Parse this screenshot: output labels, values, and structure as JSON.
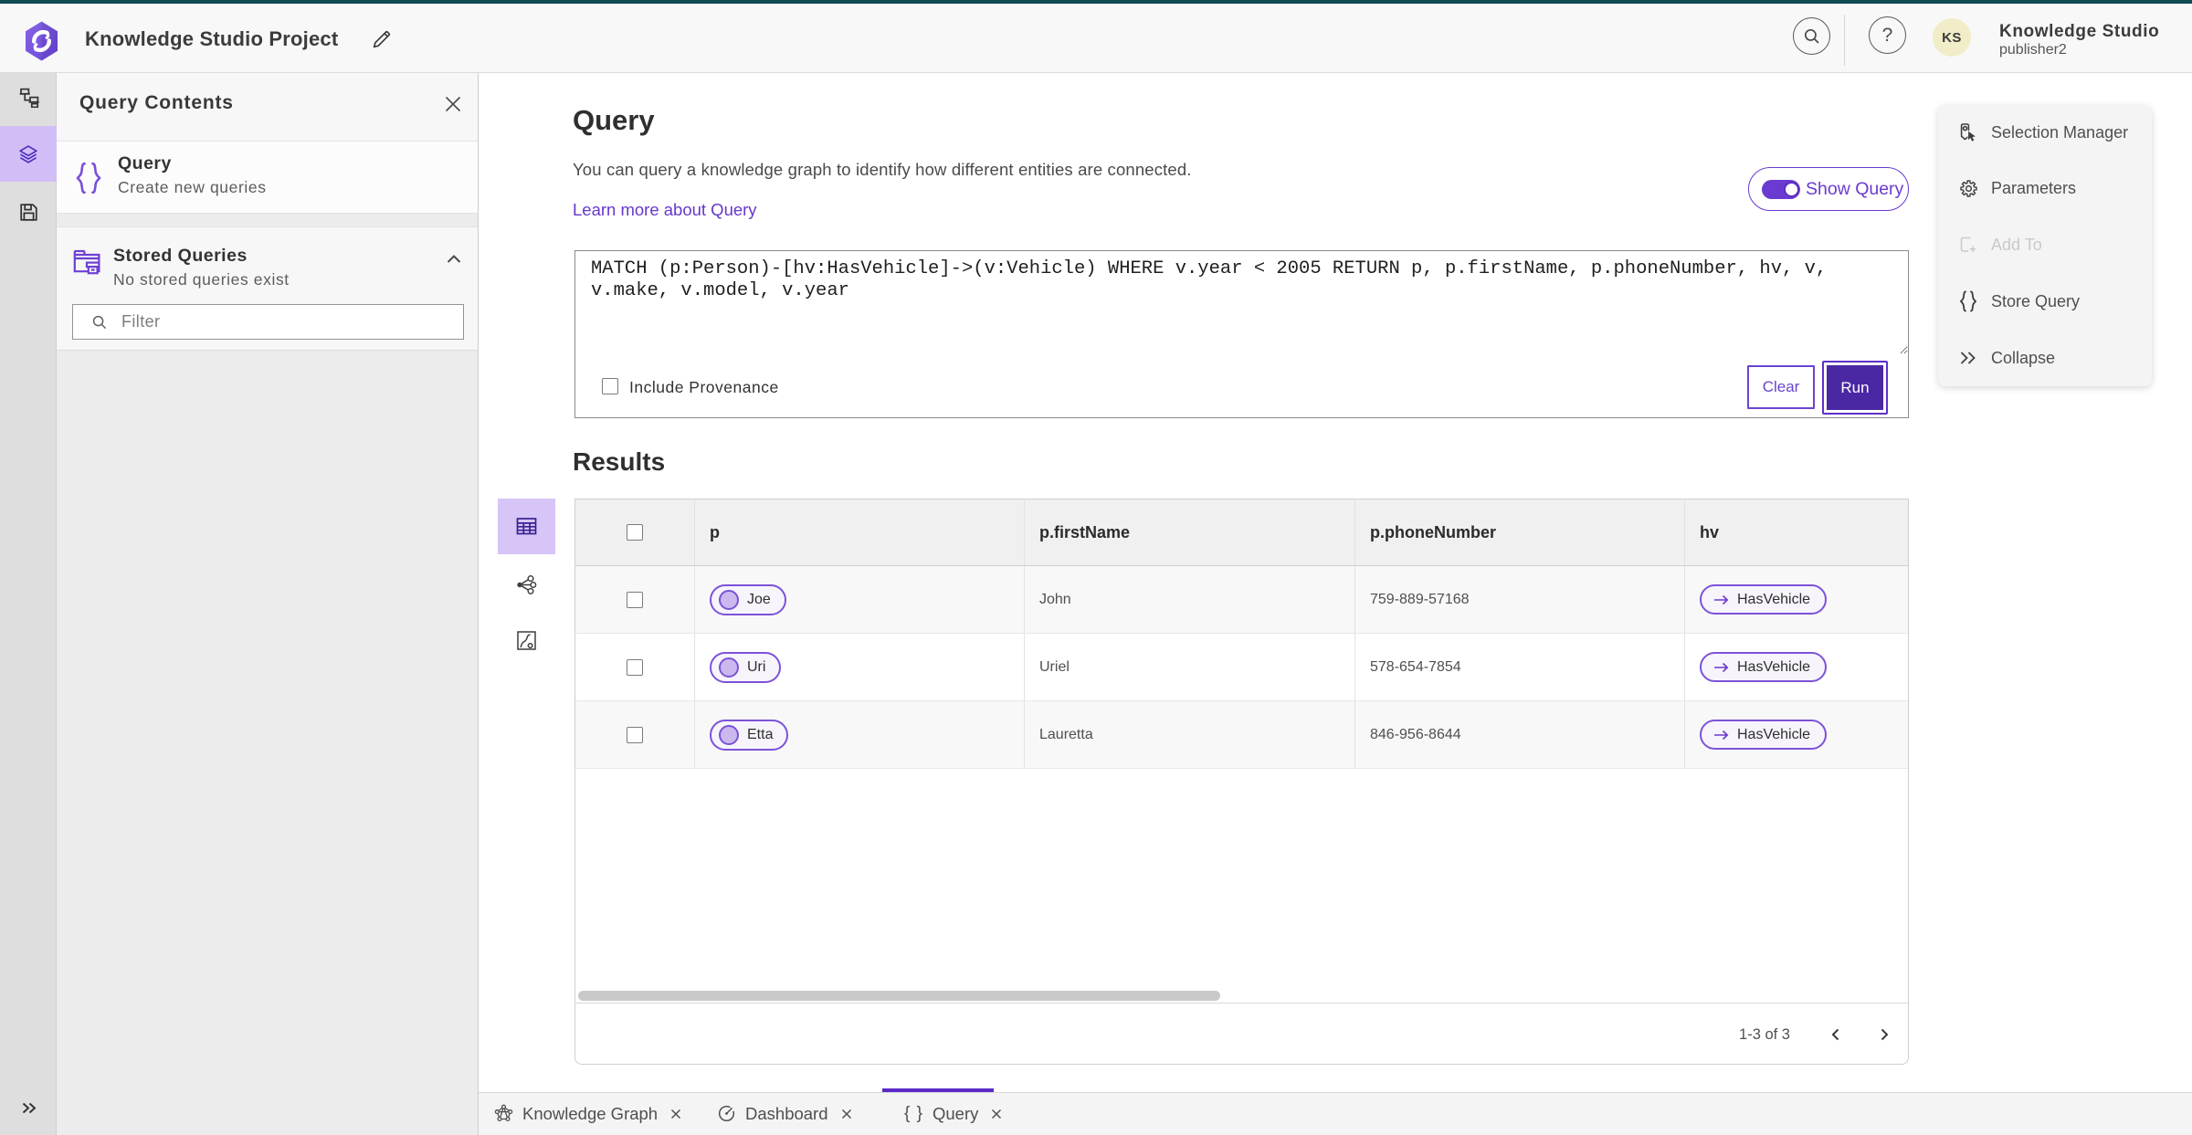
{
  "colors": {
    "topbar_teal": "#0e4a52",
    "accent_purple": "#6a3ad1",
    "run_fill": "#4a28a4",
    "selected_rail_bg": "#d2bef6",
    "avatar_bg": "#f1edc9"
  },
  "header": {
    "app_title": "Knowledge Studio Project",
    "help_glyph": "?",
    "user_initials": "KS",
    "org_name": "Knowledge Studio",
    "user_name": "publisher2"
  },
  "panel": {
    "title": "Query Contents",
    "query_item": {
      "title": "Query",
      "subtitle": "Create new queries"
    },
    "stored": {
      "title": "Stored Queries",
      "subtitle": "No stored queries exist"
    },
    "filter_placeholder": "Filter"
  },
  "main": {
    "heading": "Query",
    "description": "You can query a knowledge graph to identify how different entities are connected.",
    "link_label": "Learn more about Query",
    "toggle_label": "Show Query",
    "query_text": "MATCH (p:Person)-[hv:HasVehicle]->(v:Vehicle) WHERE v.year < 2005 RETURN p, p.firstName, p.phoneNumber, hv, v, v.make, v.model, v.year",
    "include_provenance_label": "Include Provenance",
    "clear_label": "Clear",
    "run_label": "Run",
    "results_heading": "Results"
  },
  "table": {
    "columns": [
      "p",
      "p.firstName",
      "p.phoneNumber",
      "hv"
    ],
    "rows": [
      {
        "p": "Joe",
        "first_name": "John",
        "phone": "759-889-57168",
        "hv": "HasVehicle"
      },
      {
        "p": "Uri",
        "first_name": "Uriel",
        "phone": "578-654-7854",
        "hv": "HasVehicle"
      },
      {
        "p": "Etta",
        "first_name": "Lauretta",
        "phone": "846-956-8644",
        "hv": "HasVehicle"
      }
    ],
    "pagination_label": "1-3 of 3"
  },
  "context_menu": {
    "items": [
      {
        "label": "Selection Manager"
      },
      {
        "label": "Parameters"
      },
      {
        "label": "Add To",
        "disabled": true
      },
      {
        "label": "Store Query"
      },
      {
        "label": "Collapse"
      }
    ]
  },
  "tabs": [
    {
      "label": "Knowledge Graph"
    },
    {
      "label": "Dashboard"
    },
    {
      "label": "Query",
      "active": true
    }
  ],
  "icons": {
    "braces": "{ }"
  }
}
